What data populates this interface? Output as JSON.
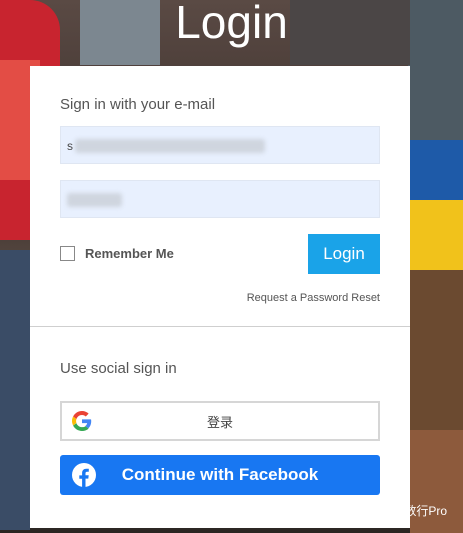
{
  "page": {
    "title": "Login"
  },
  "email_section": {
    "heading": "Sign in with your e-mail",
    "email_value": "s",
    "password_value": ""
  },
  "remember_me": {
    "label": "Remember Me",
    "checked": false
  },
  "login_button": {
    "label": "Login"
  },
  "reset_link": {
    "label": "Request a Password Reset"
  },
  "social_section": {
    "heading": "Use social sign in",
    "google_label": "登录",
    "facebook_label": "Continue with Facebook"
  },
  "watermark": {
    "text": "少年数行Pro"
  },
  "colors": {
    "login_button": "#1aa3e8",
    "facebook": "#1877f2",
    "input_bg": "#e8f0fe"
  },
  "icons": [
    "google-icon",
    "facebook-icon",
    "wechat-icon"
  ]
}
